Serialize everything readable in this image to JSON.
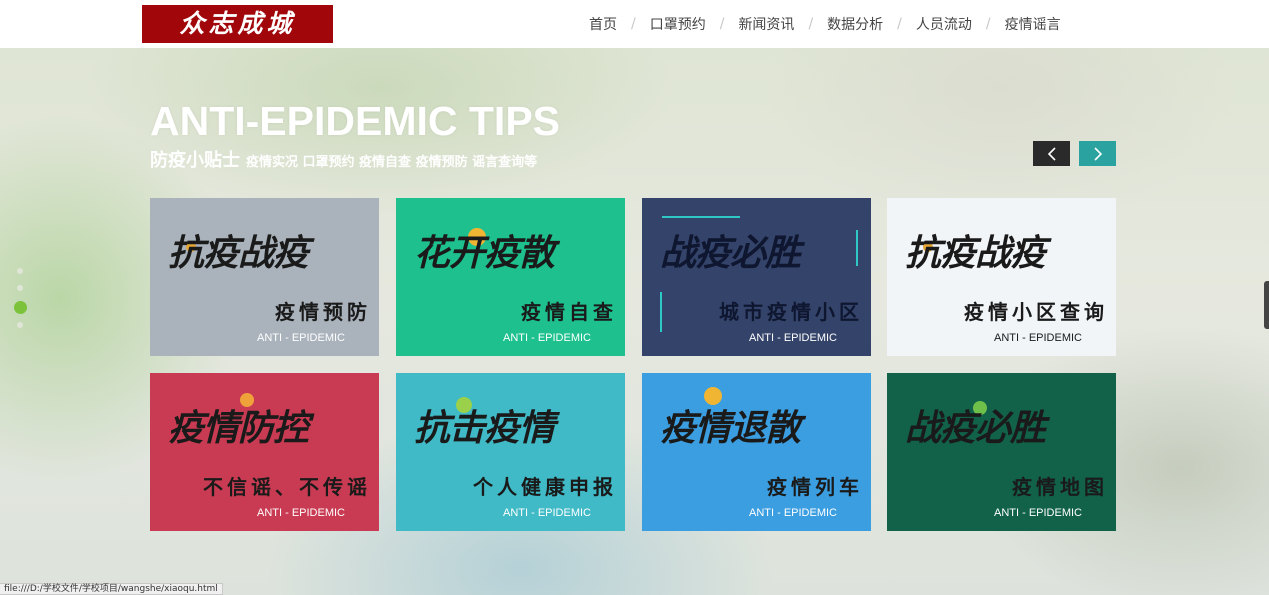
{
  "header": {
    "logo_text": "众志成城",
    "nav": [
      "首页",
      "口罩预约",
      "新闻资讯",
      "数据分析",
      "人员流动",
      "疫情谣言"
    ],
    "separator": "/"
  },
  "section": {
    "title": "ANTI-EPIDEMIC TIPS",
    "subtitle_main": "防疫小贴士",
    "subtitle_tags": "疫情实况 口罩预约 疫情自查 疫情预防 谣言查询等",
    "prev_arrow": "<",
    "next_arrow": ">"
  },
  "cards": [
    {
      "title": "抗疫战疫",
      "subtitle": "疫情预防",
      "en": "ANTI - EPIDEMIC",
      "bg": "#aab3bc"
    },
    {
      "title": "花开疫散",
      "subtitle": "疫情自查",
      "en": "ANTI - EPIDEMIC",
      "bg": "#1ec18e"
    },
    {
      "title": "战疫必胜",
      "subtitle": "城市疫情小区",
      "en": "ANTI - EPIDEMIC",
      "bg": "#344369"
    },
    {
      "title": "抗疫战疫",
      "subtitle": "疫情小区查询",
      "en": "ANTI - EPIDEMIC",
      "bg": "#f1f5f8"
    },
    {
      "title": "疫情防控",
      "subtitle": "不信谣、不传谣",
      "en": "ANTI - EPIDEMIC",
      "bg": "#c93b52"
    },
    {
      "title": "抗击疫情",
      "subtitle": "个人健康申报",
      "en": "ANTI - EPIDEMIC",
      "bg": "#3fbac6"
    },
    {
      "title": "疫情退散",
      "subtitle": "疫情列车",
      "en": "ANTI - EPIDEMIC",
      "bg": "#3b9ee0"
    },
    {
      "title": "战疫必胜",
      "subtitle": "疫情地图",
      "en": "ANTI - EPIDEMIC",
      "bg": "#116249"
    }
  ],
  "status_bar": "file:///D:/学校文件/学校项目/wangshe/xiaoqu.html",
  "colors": {
    "accent_green": "#7cc23a",
    "arrow_dark": "#2a2a2a",
    "arrow_teal": "#2aa3a0",
    "logo_red": "#a1060b"
  }
}
